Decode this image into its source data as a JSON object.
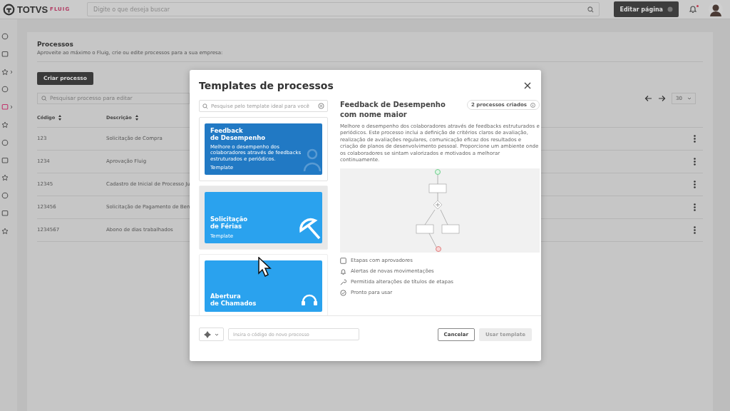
{
  "header": {
    "brand": "TOTVS",
    "product": "FLUIG",
    "search_placeholder": "Digite o que deseja buscar",
    "edit_button": "Editar página",
    "notifications_unread": true
  },
  "sidebar": {
    "items": [
      {
        "expandable": false,
        "selected": false
      },
      {
        "expandable": false,
        "selected": false
      },
      {
        "expandable": true,
        "selected": false
      },
      {
        "expandable": false,
        "selected": false
      },
      {
        "expandable": true,
        "selected": true
      },
      {
        "expandable": false,
        "selected": false
      },
      {
        "expandable": false,
        "selected": false
      },
      {
        "expandable": false,
        "selected": false
      },
      {
        "expandable": false,
        "selected": false
      },
      {
        "expandable": false,
        "selected": false
      },
      {
        "expandable": false,
        "selected": false
      },
      {
        "expandable": false,
        "selected": false
      }
    ]
  },
  "page": {
    "title": "Processos",
    "subtitle": "Aproveite ao máximo o Fluig, crie ou edite processos para a sua empresa:",
    "create_button": "Criar processo",
    "search_placeholder": "Pesquisar processo para editar",
    "page_size": "30",
    "table": {
      "columns": [
        {
          "label": "Código",
          "sortable": true
        },
        {
          "label": "Descrição",
          "sortable": true
        }
      ],
      "rows": [
        {
          "code": "123",
          "description": "Solicitação de Compra"
        },
        {
          "code": "1234",
          "description": "Aprovação Fluig"
        },
        {
          "code": "12345",
          "description": "Cadastro de Inicial de Processo Ju"
        },
        {
          "code": "123456",
          "description": "Solicitação de Pagamento de Ben"
        },
        {
          "code": "1234567",
          "description": "Abono de dias trabalhados"
        }
      ]
    }
  },
  "modal": {
    "title": "Templates de processos",
    "search_placeholder": "Pesquise pelo template ideal para você",
    "templates": [
      {
        "title_lines": [
          "Feedback",
          "de Desempenho"
        ],
        "description": "Melhore o desempenho dos colaboradores através de feedbacks estruturados e periódicos.",
        "tag": "Template",
        "color": "#2179c4",
        "selected": true,
        "hovered": false
      },
      {
        "title_lines": [
          "Solicitação",
          "de Férias"
        ],
        "tag": "Template",
        "color": "#2aa2ee",
        "selected": false,
        "hovered": true
      },
      {
        "title_lines": [
          "Abertura",
          "de Chamados"
        ],
        "color": "#2aa2ee",
        "selected": false,
        "hovered": false
      }
    ],
    "detail": {
      "title": "Feedback de Desempenho com nome maior",
      "badge": "2 processos criados",
      "description": "Melhore o desempenho dos colaboradores através de feedbacks estruturados e periódicos. Este processo inclui a definição de critérios claros de avaliação, realização de avaliações regulares, comunicação eficaz dos resultados e criação de planos de desenvolvimento pessoal. Proporcione um ambiente onde os colaboradores se sintam valorizados e motivados a melhorar continuamente.",
      "features": [
        "Etapas com aprovadores",
        "Alertas de novas movimentações",
        "Permitida alterações de títulos de etapas",
        "Pronto para usar"
      ]
    },
    "code_placeholder": "Insira o código do novo processo",
    "cancel_button": "Cancelar",
    "use_button": {
      "label": "Usar template",
      "disabled": true
    }
  }
}
